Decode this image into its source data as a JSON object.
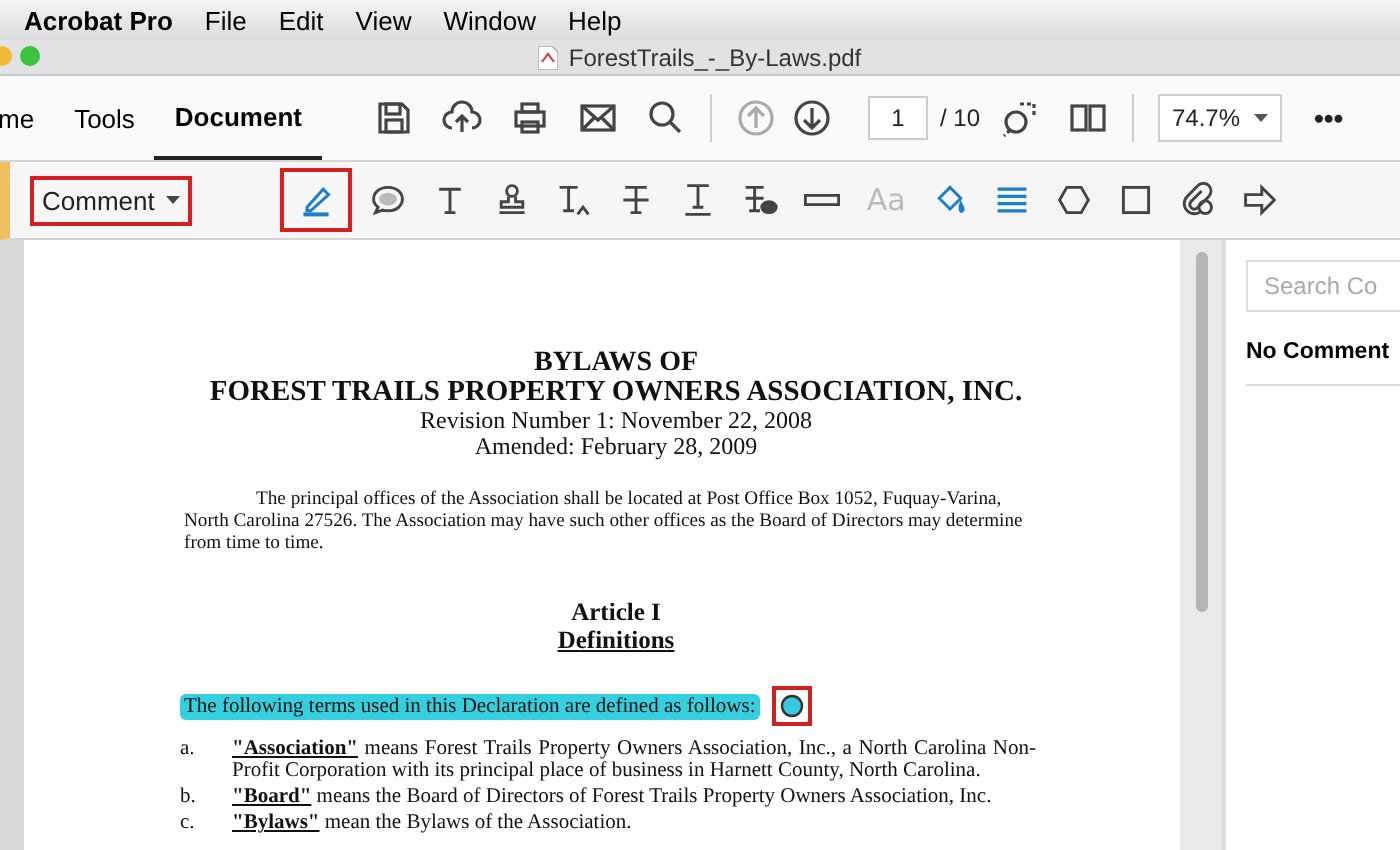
{
  "menu_bar": {
    "app": "Acrobat Pro",
    "items": [
      "File",
      "Edit",
      "View",
      "Window",
      "Help"
    ]
  },
  "window": {
    "title": "ForestTrails_-_By-Laws.pdf"
  },
  "tabs": [
    {
      "label": "me",
      "selected": false
    },
    {
      "label": "Tools",
      "selected": false
    },
    {
      "label": "Document",
      "selected": true
    }
  ],
  "toolbar": {
    "buttons": [
      {
        "kind": "save"
      },
      {
        "kind": "upload"
      },
      {
        "kind": "print"
      },
      {
        "kind": "mail"
      },
      {
        "kind": "search"
      }
    ],
    "nav": [
      {
        "kind": "up",
        "disabled": true
      },
      {
        "kind": "down",
        "disabled": false
      }
    ],
    "page_number": "1",
    "page_total": "/ 10",
    "zoom": "74.7%",
    "more": "•••"
  },
  "comment_bar": {
    "mode": "Comment",
    "callout": true,
    "tools": [
      {
        "kind": "highlight",
        "selected": true
      },
      {
        "kind": "note",
        "selected": false
      },
      {
        "kind": "text",
        "selected": false
      },
      {
        "kind": "stamp",
        "selected": false
      },
      {
        "kind": "insert",
        "selected": false
      },
      {
        "kind": "strike",
        "selected": false
      },
      {
        "kind": "underline",
        "selected": false
      },
      {
        "kind": "replace",
        "selected": false
      },
      {
        "kind": "line",
        "selected": false
      },
      {
        "kind": "font",
        "label": "Aa",
        "disabled": true,
        "selected": false
      },
      {
        "kind": "fill",
        "selected": false
      },
      {
        "kind": "lines",
        "selected": false
      },
      {
        "kind": "hexagon",
        "selected": false
      },
      {
        "kind": "rectangle",
        "selected": false
      },
      {
        "kind": "attach",
        "selected": false
      },
      {
        "kind": "arrow",
        "selected": false
      }
    ]
  },
  "document": {
    "title": "BYLAWS OF",
    "subtitle": "FOREST TRAILS PROPERTY OWNERS ASSOCIATION, INC.",
    "revision": "Revision Number 1:  November 22, 2008",
    "amended": "Amended:  February 28, 2009",
    "intro": "The principal offices of the Association shall be located at Post Office Box 1052, Fuquay-Varina, North Carolina 27526. The Association may have such other offices as the Board of Directors may determine from time to time.",
    "article": "Article I",
    "article_title": "Definitions",
    "lead": {
      "text": "The following terms used in this Declaration are defined as follows:",
      "highlighted": true,
      "comment_marker": true
    },
    "definitions": [
      {
        "marker": "a.",
        "term": "\"Association\"",
        "text": "means Forest Trails Property Owners Association, Inc., a North Carolina Non-Profit Corporation with its principal place of business in Harnett County, North Carolina."
      },
      {
        "marker": "b.",
        "term": "\"Board\"",
        "text": "means the Board of Directors of Forest Trails Property Owners Association, Inc."
      },
      {
        "marker": "c.",
        "term": "\"Bylaws\"",
        "text": "mean the Bylaws of the Association."
      }
    ]
  },
  "comments_panel": {
    "search_placeholder": "Search Co",
    "empty": "No Comment"
  }
}
